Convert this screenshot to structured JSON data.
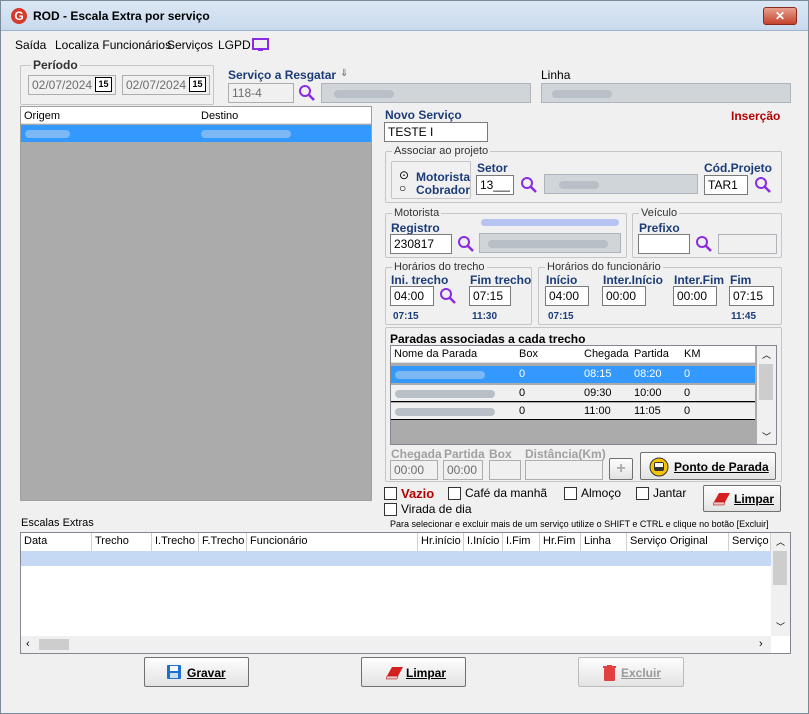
{
  "window": {
    "title": "ROD - Escala Extra por serviço",
    "close_label": "✕"
  },
  "menu": [
    "Saída",
    "Localiza Funcionários",
    "Serviços",
    "LGPD"
  ],
  "periodo": {
    "label": "Período",
    "date_from": "02/07/2024",
    "date_to": "02/07/2024",
    "cal_label": "15"
  },
  "servico_resgatar": {
    "label": "Serviço a Resgatar",
    "value": "118-4"
  },
  "linha": {
    "label": "Linha"
  },
  "origem_destino": {
    "col_origem": "Origem",
    "col_destino": "Destino"
  },
  "novo_servico": {
    "label": "Novo Serviço",
    "value": "TESTE I",
    "mode": "Inserção"
  },
  "associar": {
    "label": "Associar ao projeto",
    "opt_motorista": "Motorista",
    "opt_cobrador": "Cobrador",
    "setor_label": "Setor",
    "setor_value": "13___",
    "cod_projeto_label": "Cód.Projeto",
    "cod_projeto_value": "TAR1"
  },
  "motorista": {
    "label": "Motorista",
    "registro_label": "Registro",
    "registro_value": "230817"
  },
  "veiculo": {
    "label": "Veículo",
    "prefixo_label": "Prefixo",
    "prefixo_value": ""
  },
  "horarios_trecho": {
    "label": "Horários do trecho",
    "ini_label": "Ini. trecho",
    "fim_label": "Fim trecho",
    "ini_value": "04:00",
    "fim_value": "07:15",
    "ini_sub": "07:15",
    "fim_sub": "11:30"
  },
  "horarios_func": {
    "label": "Horários do funcionário",
    "inicio_label": "Início",
    "inter_inicio_label": "Inter.Início",
    "inter_fim_label": "Inter.Fim",
    "fim_label": "Fim",
    "inicio_value": "04:00",
    "inter_inicio_value": "00:00",
    "inter_fim_value": "00:00",
    "fim_value": "07:15",
    "inicio_sub": "07:15",
    "fim_sub": "11:45"
  },
  "paradas": {
    "label": "Paradas associadas a cada trecho",
    "headers": [
      "Nome da Parada",
      "Box",
      "Chegada",
      "Partida",
      "KM"
    ],
    "rows": [
      {
        "box": "0",
        "chegada": "08:15",
        "partida": "08:20",
        "km": "0"
      },
      {
        "box": "0",
        "chegada": "09:30",
        "partida": "10:00",
        "km": "0"
      },
      {
        "box": "0",
        "chegada": "11:00",
        "partida": "11:05",
        "km": "0"
      }
    ],
    "chegada_label": "Chegada",
    "partida_label": "Partida",
    "box_label": "Box",
    "distancia_label": "Distância(Km)",
    "chegada_value": "00:00",
    "partida_value": "00:00",
    "add_label": "+",
    "ponto_label": "Ponto de Parada"
  },
  "checks": {
    "vazio": "Vazio",
    "cafe": "Café da manhã",
    "almoco": "Almoço",
    "jantar": "Jantar",
    "virada": "Virada de dia",
    "limpar": "Limpar"
  },
  "escalas": {
    "label": "Escalas Extras",
    "hint": "Para selecionar e excluir mais de um serviço utilize o SHIFT e CTRL e clique no botão [Excluir]",
    "headers": [
      "Data",
      "Trecho",
      "I.Trecho",
      "F.Trecho",
      "Funcionário",
      "Hr.início",
      "I.Início",
      "I.Fim",
      "Hr.Fim",
      "Linha",
      "Serviço Original",
      "Serviço"
    ]
  },
  "buttons": {
    "gravar": "Gravar",
    "limpar": "Limpar",
    "excluir": "Excluir"
  }
}
